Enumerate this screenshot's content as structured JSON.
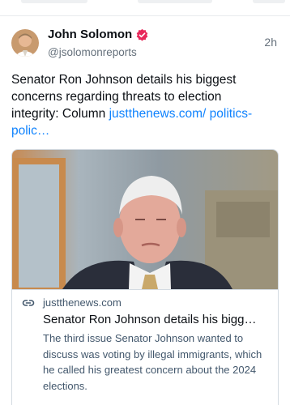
{
  "author": {
    "display_name": "John Solomon",
    "handle": "@jsolomonreports",
    "verified_badge_color": "#e8295b"
  },
  "post": {
    "timestamp": "2h",
    "text": "Senator Ron Johnson details his biggest concerns regarding threats to election integrity: Column ",
    "link_text": "justthenews.com/ politics-polic…"
  },
  "link_card": {
    "domain": "justthenews.com",
    "title": "Senator Ron Johnson details his bigg…",
    "description": "The third issue Senator Johnson wanted to discuss was voting by illegal immigrants, which he called his greatest concern about the 2024 elections."
  },
  "colors": {
    "link": "#1083fe",
    "muted": "#66717c",
    "border": "#d4dbe2"
  }
}
